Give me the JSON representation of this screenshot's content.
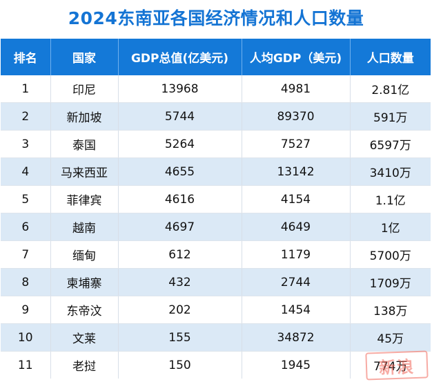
{
  "title": "2024东南亚各国经济情况和人口数量",
  "headers": [
    "排名",
    "国家",
    "GDP总值(亿美元)",
    "人均GDP（美元)",
    "人口数量"
  ],
  "rows": [
    [
      "1",
      "印尼",
      "13968",
      "4981",
      "2.81亿"
    ],
    [
      "2",
      "新加坡",
      "5744",
      "89370",
      "591万"
    ],
    [
      "3",
      "泰国",
      "5264",
      "7527",
      "6597万"
    ],
    [
      "4",
      "马来西亚",
      "4655",
      "13142",
      "3410万"
    ],
    [
      "5",
      "菲律宾",
      "4616",
      "4154",
      "1.1亿"
    ],
    [
      "6",
      "越南",
      "4697",
      "4649",
      "1亿"
    ],
    [
      "7",
      "缅甸",
      "612",
      "1179",
      "5700万"
    ],
    [
      "8",
      "柬埔寨",
      "432",
      "2744",
      "1709万"
    ],
    [
      "9",
      "东帝汶",
      "202",
      "1454",
      "138万"
    ],
    [
      "10",
      "文莱",
      "155",
      "34872",
      "45万"
    ],
    [
      "11",
      "老挝",
      "150",
      "1945",
      "774万"
    ]
  ],
  "watermark": "新浪",
  "colors": {
    "title": "#1474d4",
    "header_bg": "#1479d8",
    "header_text": "#ffffff",
    "alt_row_bg": "#dbe9f6",
    "watermark": "#f1685a"
  }
}
